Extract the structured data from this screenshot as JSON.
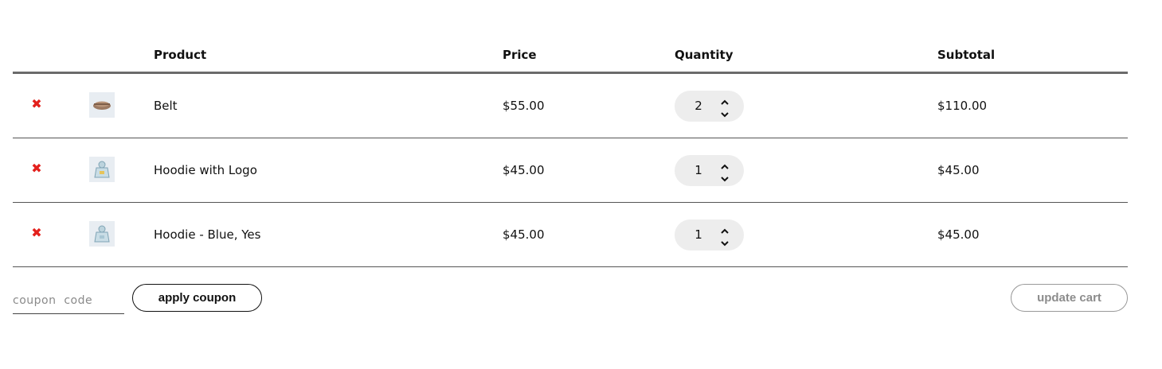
{
  "table": {
    "headers": {
      "product": "Product",
      "price": "Price",
      "quantity": "Quantity",
      "subtotal": "Subtotal"
    },
    "rows": [
      {
        "remove_icon": "remove-icon",
        "thumb_icon": "belt-thumbnail",
        "product": "Belt",
        "price": "$55.00",
        "quantity": "2",
        "subtotal": "$110.00"
      },
      {
        "remove_icon": "remove-icon",
        "thumb_icon": "hoodie-thumbnail",
        "product": "Hoodie with Logo",
        "price": "$45.00",
        "quantity": "1",
        "subtotal": "$45.00"
      },
      {
        "remove_icon": "remove-icon",
        "thumb_icon": "hoodie-thumbnail",
        "product": "Hoodie - Blue, Yes",
        "price": "$45.00",
        "quantity": "1",
        "subtotal": "$45.00"
      }
    ]
  },
  "coupon": {
    "placeholder": "coupon  code",
    "value": "",
    "apply_label": "apply coupon"
  },
  "update_cart_label": "update cart",
  "colors": {
    "remove": "#e3201c",
    "qty_bg": "#ededed",
    "header_rule": "#6b6b6b"
  }
}
